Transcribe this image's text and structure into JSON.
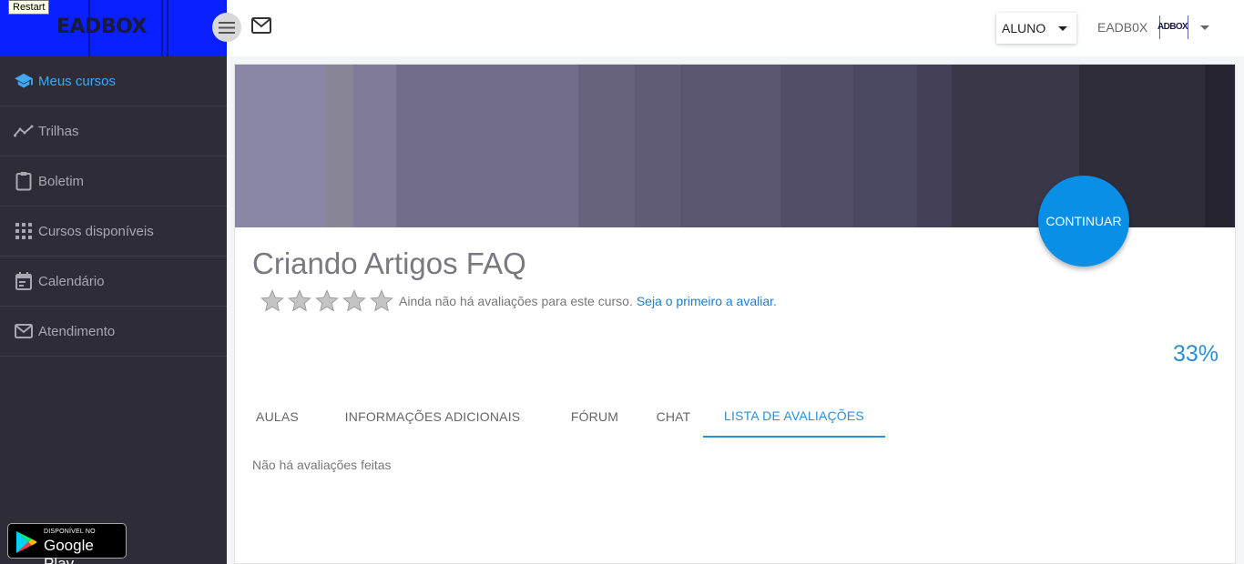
{
  "overlay": {
    "restart_label": "Restart"
  },
  "brand": {
    "logo_text": "EADBOX",
    "logo_color": "#0a20ff"
  },
  "sidebar": {
    "items": [
      {
        "label": "Meus cursos",
        "icon": "graduation-cap-icon",
        "active": true
      },
      {
        "label": "Trilhas",
        "icon": "trend-line-icon",
        "active": false
      },
      {
        "label": "Boletim",
        "icon": "clipboard-icon",
        "active": false
      },
      {
        "label": "Cursos disponíveis",
        "icon": "grid-icon",
        "active": false
      },
      {
        "label": "Calendário",
        "icon": "calendar-icon",
        "active": false
      },
      {
        "label": "Atendimento",
        "icon": "mail-icon",
        "active": false
      }
    ],
    "google_play": {
      "small": "DISPONÍVEL NO",
      "big": "Google Play"
    }
  },
  "topbar": {
    "role": "ALUNO",
    "user_name": "EADB0X",
    "avatar_text": "ADBOX"
  },
  "course": {
    "title": "Criando Artigos FAQ",
    "continue_label": "CONTINUAR",
    "rating_stars": 0,
    "rating_max": 5,
    "rating_text": "Ainda não há avaliações para este curso.",
    "rating_link": "Seja o primeiro a avaliar.",
    "progress": "33%",
    "tabs": [
      {
        "label": "AULAS",
        "active": false
      },
      {
        "label": "INFORMAÇÕES ADICIONAIS",
        "active": false
      },
      {
        "label": "FÓRUM",
        "active": false
      },
      {
        "label": "CHAT",
        "active": false
      },
      {
        "label": "LISTA DE AVALIAÇÕES",
        "active": true
      }
    ],
    "empty_message": "Não há avaliações feitas"
  },
  "colors": {
    "accent": "#2b8fd8",
    "sidebar_bg": "#2e2c36",
    "continue_bg": "#0a8fe6"
  }
}
